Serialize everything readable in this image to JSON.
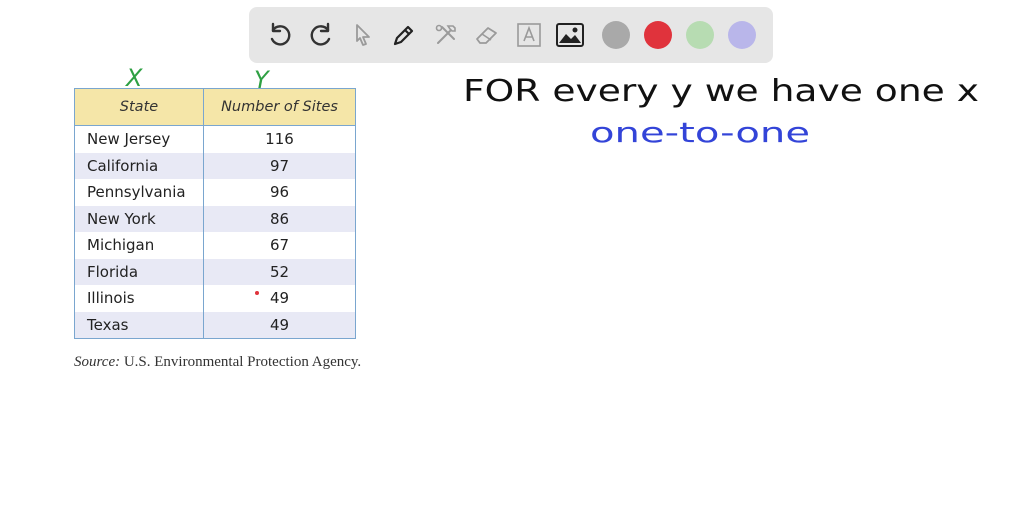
{
  "toolbar": {
    "tools": [
      "undo-icon",
      "redo-icon",
      "pointer-icon",
      "pen-icon",
      "tools-icon",
      "eraser-icon",
      "text-icon",
      "image-icon"
    ],
    "colors": [
      "#a9a9a9",
      "#e0333c",
      "#b7dcb2",
      "#b9b6ea"
    ]
  },
  "table": {
    "headers": [
      "State",
      "Number of Sites"
    ],
    "rows": [
      [
        "New Jersey",
        "116"
      ],
      [
        "California",
        "97"
      ],
      [
        "Pennsylvania",
        "96"
      ],
      [
        "New York",
        "86"
      ],
      [
        "Michigan",
        "67"
      ],
      [
        "Florida",
        "52"
      ],
      [
        "Illinois",
        "49"
      ],
      [
        "Texas",
        "49"
      ]
    ]
  },
  "source": {
    "label": "Source:",
    "text": "U.S. Environmental Protection Agency."
  },
  "annotations": {
    "x_label": "X",
    "y_label": "Y",
    "line1": "FOR every y we have one x",
    "line2": "one-to-one",
    "green": "#2ea043",
    "blue": "#3344d8",
    "black": "#111111"
  }
}
